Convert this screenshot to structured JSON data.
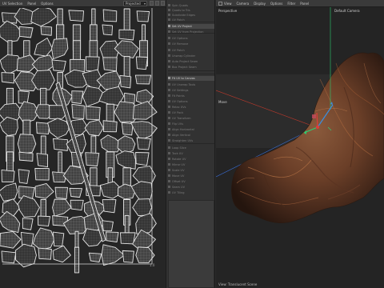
{
  "uv_editor": {
    "menus": [
      "UV Selection",
      "Panel",
      "Options"
    ],
    "projection": "Projected",
    "corner_value": "1.0"
  },
  "tool_panel": {
    "items": [
      "Spin Quads",
      "Quads to Tris",
      "Subdivide Edges",
      "UV Patch",
      "Set UV Project",
      "Set UV from Projection",
      "UV Options",
      "UV Remove",
      "UV Patch",
      "Unwrap Cylinder",
      "Auto Project Seam",
      "Box Project Seam",
      "Fit UV to Canvas",
      "UV Unwrap Tools",
      "UV Settings",
      "Fit Points",
      "UV Options",
      "Relax UVs",
      "UV Pack",
      "UV Transform",
      "Flip UVs",
      "Align Horizontal",
      "Align Vertical",
      "Straighten UVs",
      "Loop Slice",
      "Tack UV",
      "Rotate UV",
      "Mirror UV",
      "Scale UV",
      "Move UV",
      "Offset UV",
      "Seam UV",
      "UV Tiling"
    ]
  },
  "viewport": {
    "menus": [
      "View",
      "Camera",
      "Display",
      "Options",
      "Filter",
      "Panel"
    ],
    "view_label": "Perspective",
    "camera": "Default Camera",
    "tool_label": "Move",
    "status": "View: Translucent Scene",
    "axis_colors": {
      "x": "#d03030",
      "y": "#30c060",
      "z": "#3070e0"
    }
  }
}
